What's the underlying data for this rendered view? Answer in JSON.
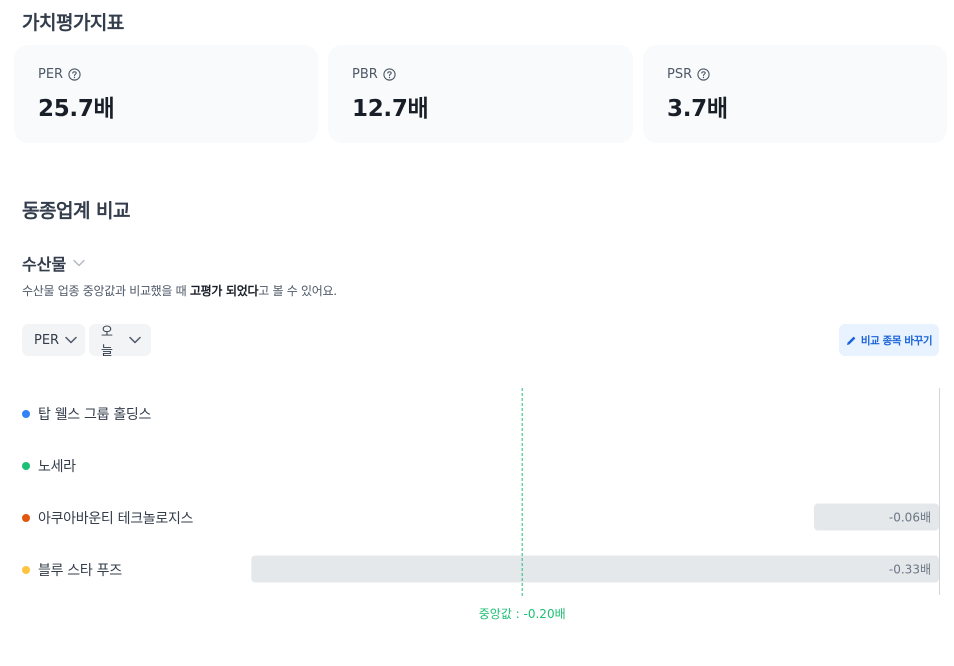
{
  "valuation": {
    "title": "가치평가지표",
    "metrics": [
      {
        "label": "PER",
        "value": "25.7배"
      },
      {
        "label": "PBR",
        "value": "12.7배"
      },
      {
        "label": "PSR",
        "value": "3.7배"
      }
    ]
  },
  "peer": {
    "title": "동종업계 비교",
    "industry": "수산물",
    "desc_prefix": "수산물 업종 중앙값과 비교했을 때 ",
    "desc_bold": "고평가 되었다",
    "desc_suffix": "고 볼 수 있어요.",
    "filter_metric": "PER",
    "filter_period": "오늘",
    "edit_label": "비교 종목 바꾸기",
    "companies": [
      {
        "name": "탑 웰스 그룹 홀딩스",
        "color": "#3182f6"
      },
      {
        "name": "노세라",
        "color": "#1dbf73"
      },
      {
        "name": "아쿠아바운티 테크놀로지스",
        "color": "#e1570f"
      },
      {
        "name": "블루 스타 푸즈",
        "color": "#ffc342"
      }
    ]
  },
  "chart_data": {
    "type": "bar",
    "orientation": "horizontal",
    "categories": [
      "탑 웰스 그룹 홀딩스",
      "노세라",
      "아쿠아바운티 테크놀로지스",
      "블루 스타 푸즈"
    ],
    "values": [
      null,
      null,
      -0.06,
      -0.33
    ],
    "value_labels": [
      "",
      "",
      "-0.06배",
      "-0.33배"
    ],
    "xlim": [
      -0.44,
      0
    ],
    "median": -0.2,
    "median_label": "중앙값 : -0.20배"
  }
}
